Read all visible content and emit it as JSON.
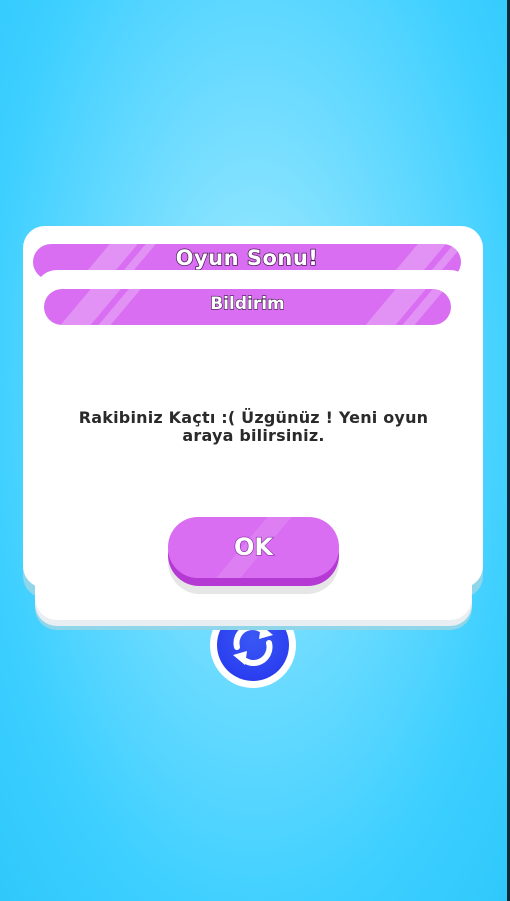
{
  "background_dialog": {
    "title": "Oyun Sonu!"
  },
  "notification_dialog": {
    "title": "Bildirim",
    "message": "Rakibiniz Kaçtı :( Üzgünüz ! Yeni oyun araya bilirsiniz.",
    "ok_label": "OK"
  },
  "refresh_button": {
    "icon": "refresh-icon"
  },
  "colors": {
    "accent_purple": "#d96ef2",
    "accent_purple_dark": "#b53ad4",
    "refresh_blue": "#2b3ff0",
    "background_blue": "#3ccfff"
  }
}
